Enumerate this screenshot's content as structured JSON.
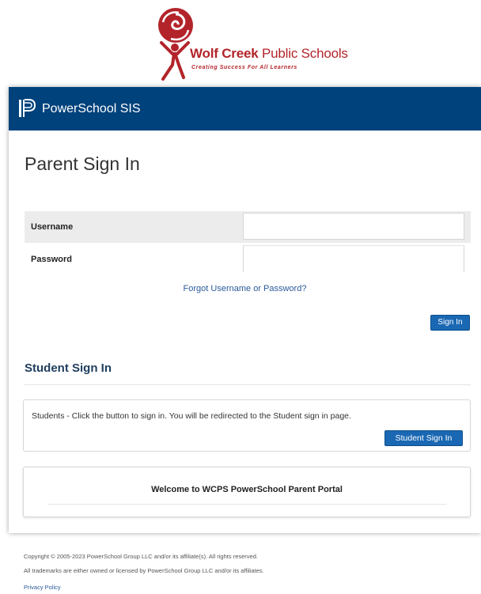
{
  "logo": {
    "name_bold": "Wolf Creek",
    "name_rest": " Public Schools",
    "tagline": "Creating Success For All Learners",
    "icon": "wolf-creek-swirl-figure-logo"
  },
  "header": {
    "title": "PowerSchool SIS",
    "icon": "powerschool-p-icon"
  },
  "page": {
    "title": "Parent Sign In"
  },
  "form": {
    "username_label": "Username",
    "username_value": "",
    "password_label": "Password",
    "password_value": "",
    "forgot_link": "Forgot Username or Password?",
    "signin_label": "Sign In"
  },
  "student": {
    "section_title": "Student Sign In",
    "instructions": "Students - Click the button to sign in. You will be redirected to the Student sign in page.",
    "button_label": "Student Sign In"
  },
  "welcome": {
    "text": "Welcome to WCPS PowerSchool Parent Portal"
  },
  "footer": {
    "copyright": "Copyright © 2005-2023 PowerSchool Group LLC and/or its affiliate(s). All rights reserved.",
    "trademarks": "All trademarks are either owned or licensed by PowerSchool Group LLC and/or its affiliates.",
    "privacy_link": "Privacy Policy"
  },
  "colors": {
    "brand_blue": "#00427c",
    "button_blue": "#1a68b3",
    "logo_red": "#b3242a"
  }
}
